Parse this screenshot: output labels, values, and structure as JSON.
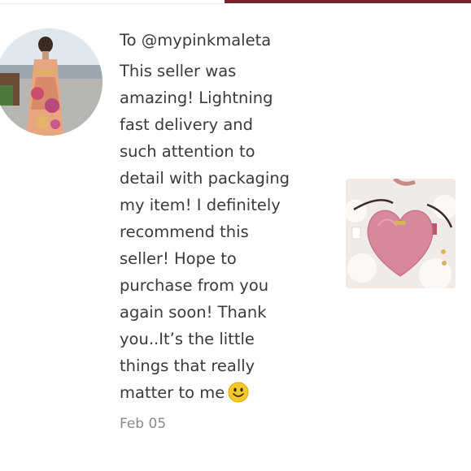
{
  "review": {
    "recipient": "To @mypinkmaleta",
    "lines": [
      "This seller was",
      "amazing! Lightning",
      "fast delivery and",
      "such attention to",
      "detail with packaging",
      "my item! I definitely",
      "recommend this",
      "seller! Hope to",
      "purchase from you",
      "again soon! Thank",
      "you..It’s the little",
      "things that really",
      "matter to me"
    ],
    "date": "Feb 05"
  },
  "icons": {
    "emoji": "smiley-emoji-icon"
  },
  "colors": {
    "accent": "#7a1f2b",
    "text": "#3a3a3a",
    "muted": "#8a8a8a",
    "emoji_face": "#f7c928"
  }
}
